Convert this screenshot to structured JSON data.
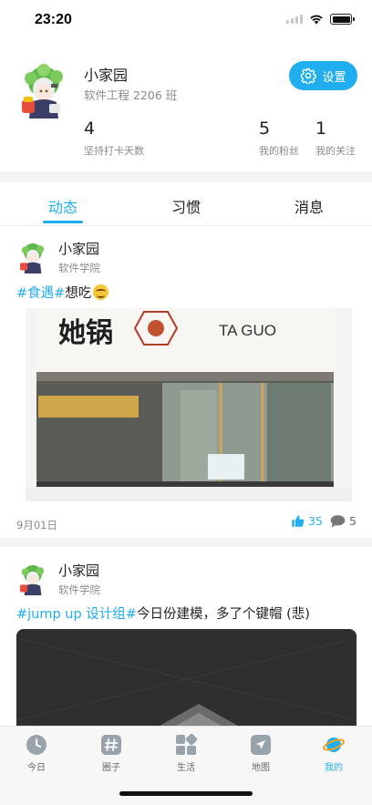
{
  "status_bar": {
    "time": "23:20"
  },
  "profile": {
    "name": "小家园",
    "class": "软件工程 2206 班",
    "settings_label": "设置",
    "stats": [
      {
        "value": "4",
        "label": "坚持打卡天数"
      },
      {
        "value": "5",
        "label": "我的粉丝"
      },
      {
        "value": "1",
        "label": "我的关注"
      }
    ]
  },
  "tabs": [
    {
      "label": "动态",
      "active": true
    },
    {
      "label": "习惯",
      "active": false
    },
    {
      "label": "消息",
      "active": false
    }
  ],
  "posts": [
    {
      "author": "小家园",
      "school": "软件学院",
      "tag1": "#食遇#",
      "text": "想吃",
      "emoji": "smiling-face-icon",
      "photo_sign_left": "她锅",
      "photo_sign_right": "TA GUO",
      "date": "9月01日",
      "likes": "35",
      "comments": "5"
    },
    {
      "author": "小家园",
      "school": "软件学院",
      "tag1": "#jump up 设计组#",
      "text": "今日份建模，多了个键帽 (悲)"
    }
  ],
  "bottom_nav": [
    {
      "label": "今日",
      "icon": "clock-icon"
    },
    {
      "label": "圈子",
      "icon": "hashtag-icon"
    },
    {
      "label": "生活",
      "icon": "grid-icon"
    },
    {
      "label": "地图",
      "icon": "navigation-icon"
    },
    {
      "label": "我的",
      "icon": "planet-icon",
      "active": true
    }
  ],
  "colors": {
    "accent": "#21aef0",
    "text": "#222222",
    "muted": "#8a8a8a"
  }
}
